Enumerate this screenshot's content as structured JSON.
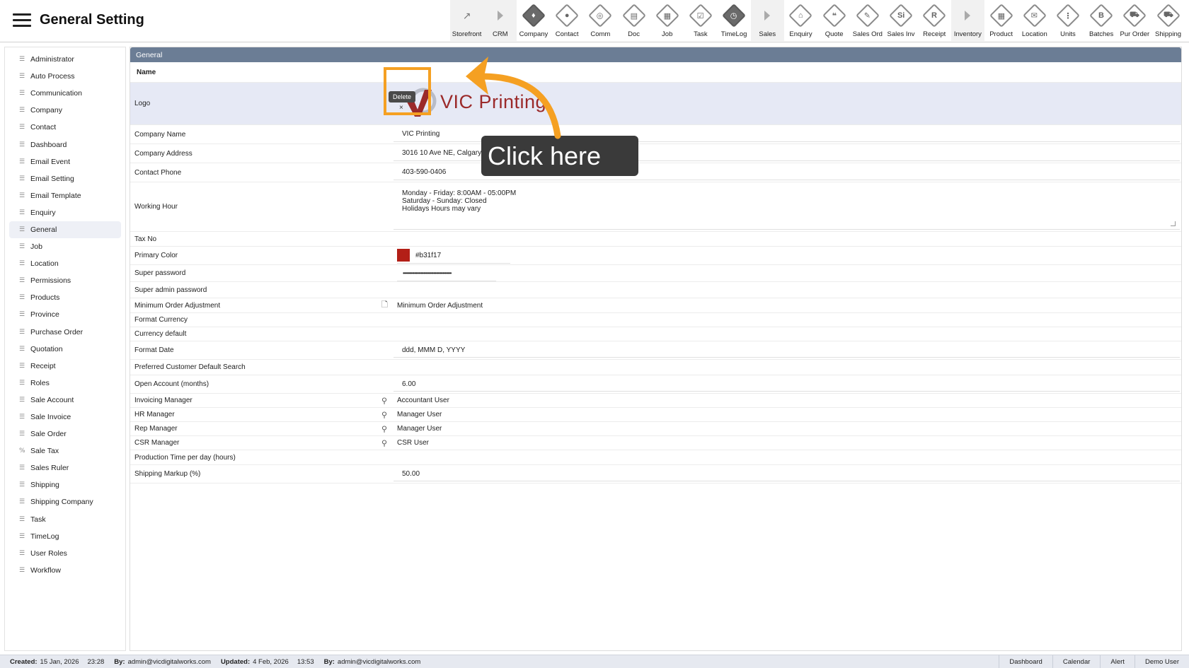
{
  "header": {
    "title": "General Setting"
  },
  "toolbar": [
    {
      "label": "Storefront",
      "glyph": "↗",
      "kind": "plain",
      "section": true
    },
    {
      "label": "CRM",
      "glyph": "",
      "kind": "arrow",
      "section": true
    },
    {
      "label": "Company",
      "glyph": "♦",
      "kind": "dark"
    },
    {
      "label": "Contact",
      "glyph": "●",
      "kind": "diamond"
    },
    {
      "label": "Comm",
      "glyph": "◎",
      "kind": "diamond"
    },
    {
      "label": "Doc",
      "glyph": "▤",
      "kind": "diamond"
    },
    {
      "label": "Job",
      "glyph": "▦",
      "kind": "diamond"
    },
    {
      "label": "Task",
      "glyph": "☑",
      "kind": "diamond"
    },
    {
      "label": "TimeLog",
      "glyph": "◷",
      "kind": "dark"
    },
    {
      "label": "Sales",
      "glyph": "",
      "kind": "arrow",
      "section": true
    },
    {
      "label": "Enquiry",
      "glyph": "⌂",
      "kind": "diamond"
    },
    {
      "label": "Quote",
      "glyph": "❝",
      "kind": "diamond"
    },
    {
      "label": "Sales Ord",
      "glyph": "✎",
      "kind": "diamond"
    },
    {
      "label": "Sales Inv",
      "glyph": "Si",
      "kind": "diamond"
    },
    {
      "label": "Receipt",
      "glyph": "R",
      "kind": "diamond"
    },
    {
      "label": "Inventory",
      "glyph": "",
      "kind": "arrow",
      "section": true
    },
    {
      "label": "Product",
      "glyph": "▦",
      "kind": "diamond"
    },
    {
      "label": "Location",
      "glyph": "✉",
      "kind": "diamond"
    },
    {
      "label": "Units",
      "glyph": "⋮",
      "kind": "diamond"
    },
    {
      "label": "Batches",
      "glyph": "B",
      "kind": "diamond"
    },
    {
      "label": "Pur Order",
      "glyph": "⛟",
      "kind": "diamond"
    },
    {
      "label": "Shipping",
      "glyph": "⛟",
      "kind": "diamond"
    }
  ],
  "sidebar": {
    "items": [
      "Administrator",
      "Auto Process",
      "Communication",
      "Company",
      "Contact",
      "Dashboard",
      "Email Event",
      "Email Setting",
      "Email Template",
      "Enquiry",
      "General",
      "Job",
      "Location",
      "Permissions",
      "Products",
      "Province",
      "Purchase Order",
      "Quotation",
      "Receipt",
      "Roles",
      "Sale Account",
      "Sale Invoice",
      "Sale Order",
      "Sale Tax",
      "Sales Ruler",
      "Shipping",
      "Shipping Company",
      "Task",
      "TimeLog",
      "User Roles",
      "Workflow"
    ],
    "active": "General",
    "percent_item": "Sale Tax"
  },
  "panel": {
    "title": "General",
    "name_label": "Name",
    "logo_label": "Logo",
    "logo_text": "VIC Printing",
    "delete_label": "Delete",
    "delete_x": "×",
    "company_name_label": "Company Name",
    "company_name": "VIC Printing",
    "company_address_label": "Company Address",
    "company_address": "3016 10 Ave NE, Calgary AB",
    "contact_phone_label": "Contact Phone",
    "contact_phone": "403-590-0406",
    "working_hour_label": "Working Hour",
    "working_hour": "Monday - Friday: 8:00AM - 05:00PM\nSaturday - Sunday: Closed\nHolidays Hours may vary",
    "tax_no_label": "Tax No",
    "primary_color_label": "Primary Color",
    "primary_color": "#b31f17",
    "super_password_label": "Super password",
    "super_password": "••••••••••••••••••••••••••••••••••••••",
    "super_admin_password_label": "Super admin password",
    "min_order_label": "Minimum Order Adjustment",
    "min_order_value": "Minimum Order Adjustment",
    "format_currency_label": "Format Currency",
    "currency_default_label": "Currency default",
    "format_date_label": "Format Date",
    "format_date": "ddd, MMM D, YYYY",
    "pref_customer_label": "Preferred Customer Default Search",
    "open_account_label": "Open Account (months)",
    "open_account": "6.00",
    "invoicing_manager_label": "Invoicing Manager",
    "invoicing_manager": "Accountant User",
    "hr_manager_label": "HR Manager",
    "hr_manager": "Manager User",
    "rep_manager_label": "Rep Manager",
    "rep_manager": "Manager User",
    "csr_manager_label": "CSR Manager",
    "csr_manager": "CSR User",
    "production_time_label": "Production Time per day (hours)",
    "shipping_markup_label": "Shipping Markup (%)",
    "shipping_markup": "50.00"
  },
  "annotation": {
    "tip_text": "Click here",
    "highlight_color": "#f5a022"
  },
  "statusbar": {
    "created_label": "Created:",
    "created_date": "15 Jan, 2026",
    "created_time": "23:28",
    "created_by_label": "By:",
    "created_by": "admin@vicdigitalworks.com",
    "updated_label": "Updated:",
    "updated_date": "4 Feb, 2026",
    "updated_time": "13:53",
    "updated_by_label": "By:",
    "updated_by": "admin@vicdigitalworks.com",
    "buttons": [
      "Dashboard",
      "Calendar",
      "Alert",
      "Demo User"
    ]
  }
}
